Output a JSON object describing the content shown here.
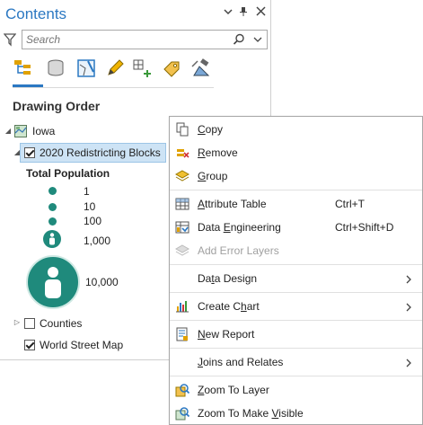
{
  "pane": {
    "title": "Contents",
    "search_placeholder": "Search",
    "heading": "Drawing Order",
    "toolbar_icons": [
      "list-by-drawing-order-icon",
      "list-by-source-icon",
      "list-by-selection-icon",
      "list-by-editing-icon",
      "list-by-snapping-icon",
      "list-by-labeling-icon",
      "list-by-perspective-imagery-icon"
    ]
  },
  "tree": {
    "map": "Iowa",
    "layer": "2020 Redistricting Blocks",
    "field": "Total Population",
    "legend": [
      "1",
      "10",
      "100",
      "1,000",
      "10,000"
    ],
    "layer2": "Counties",
    "layer3": "World Street Map"
  },
  "menu": {
    "items": [
      {
        "pre": "",
        "ul": "C",
        "post": "opy",
        "shortcut": ""
      },
      {
        "pre": "",
        "ul": "R",
        "post": "emove",
        "shortcut": ""
      },
      {
        "pre": "",
        "ul": "G",
        "post": "roup",
        "shortcut": ""
      },
      {
        "pre": "",
        "ul": "A",
        "post": "ttribute Table",
        "shortcut": "Ctrl+T"
      },
      {
        "pre": "Data ",
        "ul": "E",
        "post": "ngineering",
        "shortcut": "Ctrl+Shift+D"
      },
      {
        "pre": "Add Error Layers",
        "ul": "",
        "post": "",
        "shortcut": ""
      },
      {
        "pre": "Da",
        "ul": "t",
        "post": "a Design",
        "shortcut": ""
      },
      {
        "pre": "Create C",
        "ul": "h",
        "post": "art",
        "shortcut": ""
      },
      {
        "pre": "",
        "ul": "N",
        "post": "ew Report",
        "shortcut": ""
      },
      {
        "pre": "",
        "ul": "J",
        "post": "oins and Relates",
        "shortcut": ""
      },
      {
        "pre": "",
        "ul": "Z",
        "post": "oom To Layer",
        "shortcut": ""
      },
      {
        "pre": "Zoom To Make ",
        "ul": "V",
        "post": "isible",
        "shortcut": ""
      }
    ]
  },
  "colors": {
    "accent": "#2b78c2",
    "symbol": "#1f8a7c",
    "selection": "#cde3f5"
  }
}
